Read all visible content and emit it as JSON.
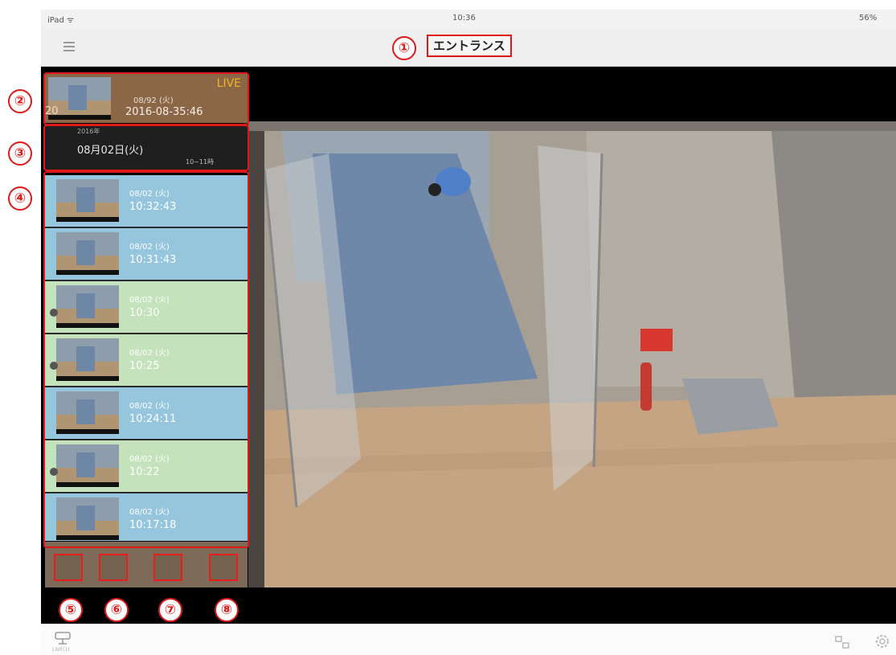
{
  "status_bar": {
    "device": "iPad ᯤ",
    "time": "10:36",
    "battery": "56%"
  },
  "nav": {
    "title": "エントランス"
  },
  "live_cell": {
    "badge": "LIVE",
    "date": "08/92 (火)",
    "time": "2016-08-35:46",
    "ghost": "20"
  },
  "date_cell": {
    "year": "2016年",
    "date": "08月02日(火)",
    "range": "10~11時"
  },
  "clips": [
    {
      "date": "08/02 (火)",
      "time": "10:32:43",
      "color": "blue"
    },
    {
      "date": "08/02 (火)",
      "time": "10:31:43",
      "color": "blue"
    },
    {
      "date": "08/02 (火)",
      "time": "10:30",
      "color": "green"
    },
    {
      "date": "08/02 (火)",
      "time": "10:25",
      "color": "green"
    },
    {
      "date": "08/02 (火)",
      "time": "10:24:11",
      "color": "blue"
    },
    {
      "date": "08/02 (火)",
      "time": "10:22",
      "color": "green"
    },
    {
      "date": "08/02 (火)",
      "time": "10:17:18",
      "color": "blue"
    }
  ],
  "bottom_bar": {
    "camera_label": "LIVE(1)"
  },
  "annotations": {
    "a1": "①",
    "a2": "②",
    "a3": "③",
    "a4": "④",
    "a5": "⑤",
    "a6": "⑥",
    "a7": "⑦",
    "a8": "⑧"
  },
  "colors": {
    "annotation": "#e01818",
    "live": "#f3b221",
    "clip_blue": "#95c6de",
    "clip_green": "#c4e2bb"
  }
}
